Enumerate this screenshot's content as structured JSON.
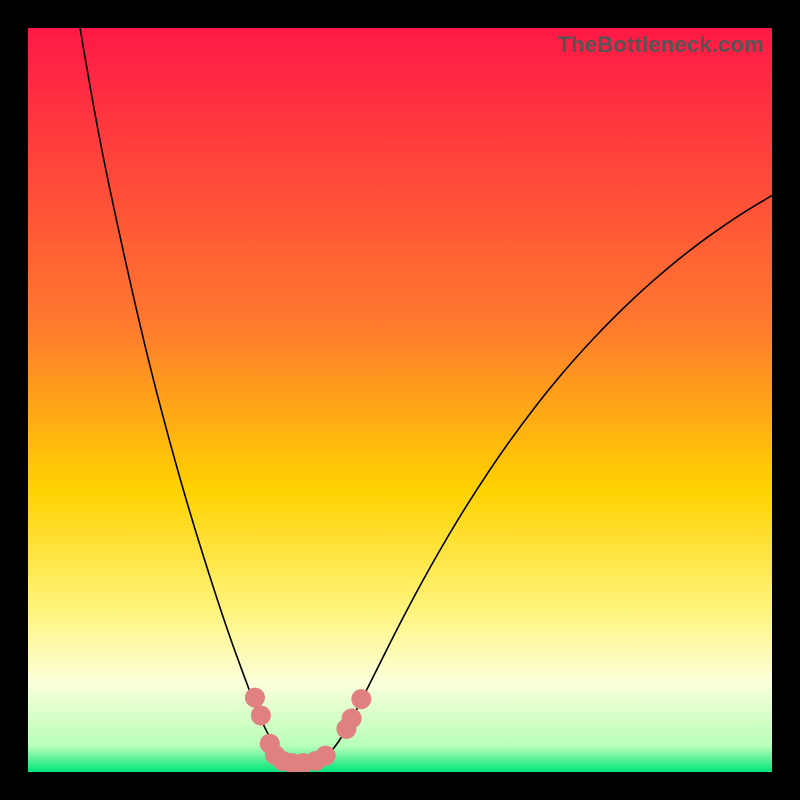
{
  "watermark": "TheBottleneck.com",
  "chart_data": {
    "type": "line",
    "title": "",
    "xlabel": "",
    "ylabel": "",
    "xlim": [
      0,
      100
    ],
    "ylim": [
      0,
      100
    ],
    "background_gradient_stops": [
      {
        "offset": 0,
        "color": "#ff1846"
      },
      {
        "offset": 0.4,
        "color": "#ff7a2e"
      },
      {
        "offset": 0.62,
        "color": "#ffd200"
      },
      {
        "offset": 0.78,
        "color": "#fff47a"
      },
      {
        "offset": 0.88,
        "color": "#fbffdb"
      },
      {
        "offset": 0.965,
        "color": "#b8ffb8"
      },
      {
        "offset": 1.0,
        "color": "#00e47a"
      }
    ],
    "series": [
      {
        "name": "bottleneck-curve",
        "type": "line",
        "stroke": "#000000",
        "stroke_width": 1.6,
        "points": [
          {
            "x": 7.0,
            "y": 100.0
          },
          {
            "x": 8.0,
            "y": 94.0
          },
          {
            "x": 10.0,
            "y": 83.0
          },
          {
            "x": 13.0,
            "y": 69.0
          },
          {
            "x": 16.0,
            "y": 56.0
          },
          {
            "x": 19.0,
            "y": 44.5
          },
          {
            "x": 22.0,
            "y": 34.0
          },
          {
            "x": 25.0,
            "y": 24.5
          },
          {
            "x": 27.0,
            "y": 18.5
          },
          {
            "x": 29.0,
            "y": 13.0
          },
          {
            "x": 30.5,
            "y": 9.0
          },
          {
            "x": 32.0,
            "y": 5.5
          },
          {
            "x": 33.5,
            "y": 3.0
          },
          {
            "x": 35.0,
            "y": 1.6
          },
          {
            "x": 36.5,
            "y": 1.0
          },
          {
            "x": 38.0,
            "y": 1.0
          },
          {
            "x": 39.5,
            "y": 1.6
          },
          {
            "x": 41.0,
            "y": 3.0
          },
          {
            "x": 42.5,
            "y": 5.2
          },
          {
            "x": 44.5,
            "y": 9.0
          },
          {
            "x": 47.0,
            "y": 14.0
          },
          {
            "x": 50.0,
            "y": 20.0
          },
          {
            "x": 54.0,
            "y": 27.5
          },
          {
            "x": 59.0,
            "y": 36.0
          },
          {
            "x": 65.0,
            "y": 45.0
          },
          {
            "x": 72.0,
            "y": 54.0
          },
          {
            "x": 80.0,
            "y": 62.5
          },
          {
            "x": 88.0,
            "y": 69.5
          },
          {
            "x": 95.0,
            "y": 74.5
          },
          {
            "x": 100.0,
            "y": 77.5
          }
        ]
      },
      {
        "name": "sample-points",
        "type": "scatter",
        "fill": "#e08080",
        "radius": 10,
        "points": [
          {
            "x": 30.5,
            "y": 10.0
          },
          {
            "x": 31.3,
            "y": 7.6
          },
          {
            "x": 32.5,
            "y": 3.8
          },
          {
            "x": 33.2,
            "y": 2.3
          },
          {
            "x": 34.2,
            "y": 1.5
          },
          {
            "x": 35.5,
            "y": 1.2
          },
          {
            "x": 37.0,
            "y": 1.2
          },
          {
            "x": 38.7,
            "y": 1.5
          },
          {
            "x": 40.0,
            "y": 2.2
          },
          {
            "x": 42.8,
            "y": 5.8
          },
          {
            "x": 43.5,
            "y": 7.2
          },
          {
            "x": 44.8,
            "y": 9.8
          }
        ]
      }
    ]
  }
}
